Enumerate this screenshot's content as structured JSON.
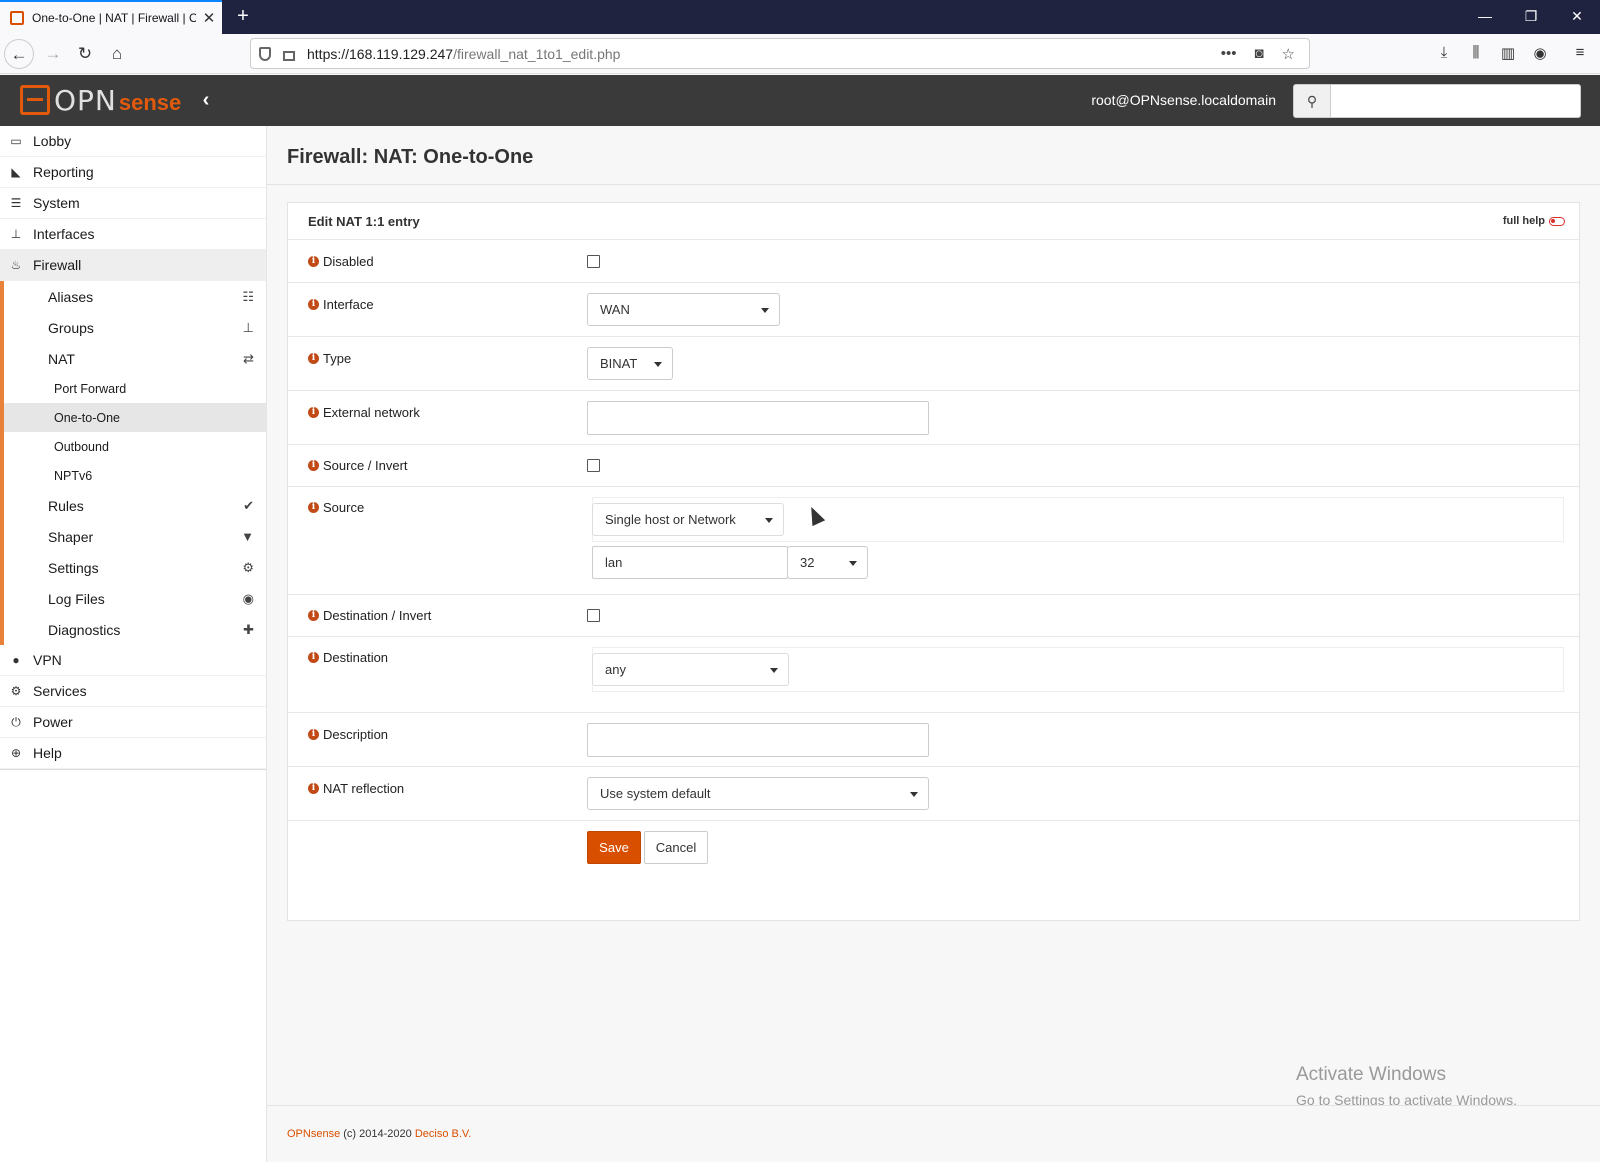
{
  "browser": {
    "tab_title": "One-to-One | NAT | Firewall | O",
    "tab_close": "✕",
    "new_tab": "+",
    "url_host": "https://168.119.129.247",
    "url_path": "/firewall_nat_1to1_edit.php",
    "url_more": "•••"
  },
  "header": {
    "logo_opn": "OPN",
    "logo_sense": "sense",
    "user": "root@OPNsense.localdomain",
    "search_placeholder": ""
  },
  "sidebar": {
    "top_items": [
      {
        "label": "Lobby",
        "icon": "laptop-icon"
      },
      {
        "label": "Reporting",
        "icon": "area-chart-icon"
      },
      {
        "label": "System",
        "icon": "server-icon"
      },
      {
        "label": "Interfaces",
        "icon": "sitemap-icon"
      },
      {
        "label": "Firewall",
        "icon": "fire-icon"
      }
    ],
    "firewall_items": [
      {
        "label": "Aliases",
        "icon": "list-icon"
      },
      {
        "label": "Groups",
        "icon": "sitemap-icon"
      },
      {
        "label": "NAT",
        "icon": "exchange-icon"
      }
    ],
    "nat_items": [
      "Port Forward",
      "One-to-One",
      "Outbound",
      "NPTv6"
    ],
    "firewall_items2": [
      {
        "label": "Rules",
        "icon": "check-icon"
      },
      {
        "label": "Shaper",
        "icon": "filter-icon"
      },
      {
        "label": "Settings",
        "icon": "cogs-icon"
      },
      {
        "label": "Log Files",
        "icon": "eye-icon"
      },
      {
        "label": "Diagnostics",
        "icon": "medkit-icon"
      }
    ],
    "bottom_items": [
      {
        "label": "VPN",
        "icon": "globe-icon"
      },
      {
        "label": "Services",
        "icon": "cog-icon"
      },
      {
        "label": "Power",
        "icon": "plug-icon"
      },
      {
        "label": "Help",
        "icon": "support-icon"
      }
    ]
  },
  "page": {
    "title": "Firewall: NAT: One-to-One",
    "panel_title": "Edit NAT 1:1 entry",
    "full_help": "full help",
    "fields": {
      "disabled": {
        "label": "Disabled",
        "checked": false
      },
      "interface": {
        "label": "Interface",
        "value": "WAN"
      },
      "type": {
        "label": "Type",
        "value": "BINAT"
      },
      "external_network": {
        "label": "External network",
        "value": ""
      },
      "source_invert": {
        "label": "Source / Invert",
        "checked": false
      },
      "source": {
        "label": "Source",
        "type_value": "Single host or Network",
        "address": "lan",
        "mask": "32"
      },
      "destination_invert": {
        "label": "Destination / Invert",
        "checked": false
      },
      "destination": {
        "label": "Destination",
        "value": "any"
      },
      "description": {
        "label": "Description",
        "value": ""
      },
      "nat_reflection": {
        "label": "NAT reflection",
        "value": "Use system default"
      }
    },
    "save_label": "Save",
    "cancel_label": "Cancel"
  },
  "watermark": {
    "line1": "Activate Windows",
    "line2": "Go to Settings to activate Windows."
  },
  "footer": {
    "brand": "OPNsense",
    "copyright": " (c) 2014-2020 ",
    "company": "Deciso B.V."
  },
  "colors": {
    "accent": "#d94f00",
    "header_bg": "#3a3a3a",
    "sidebar_accent": "#e8813a"
  }
}
